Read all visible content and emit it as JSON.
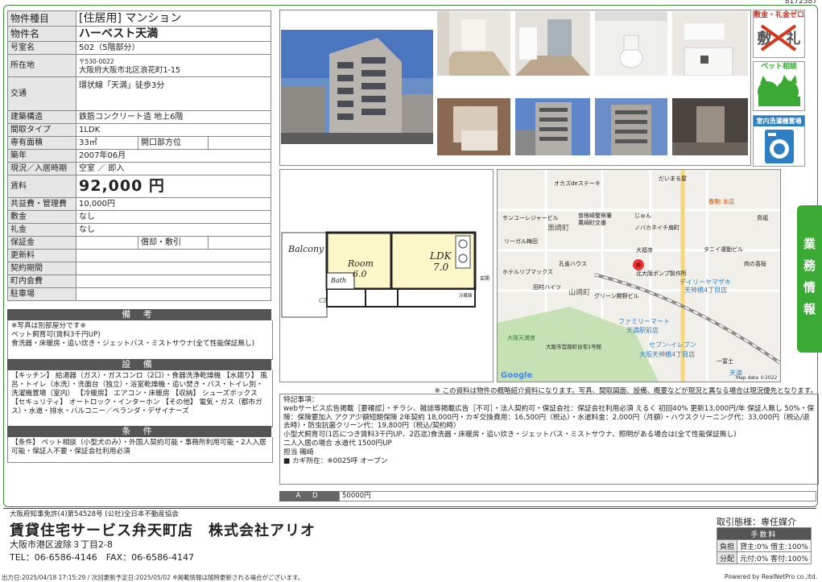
{
  "listing_id": "8172587",
  "property": {
    "rows": [
      {
        "label": "物件種目",
        "value": "[住居用] マンション"
      },
      {
        "label": "物件名",
        "value": "ハーベスト天満"
      },
      {
        "label": "号室名",
        "value": "502（5階部分）"
      },
      {
        "label": "所在地",
        "postal": "〒530-0022",
        "value": "大阪府大阪市北区浪花町1-15"
      },
      {
        "label": "交通",
        "value": "環状線「天満」徒歩3分"
      },
      {
        "label": "建築構造",
        "value": "鉄筋コンクリート造 地上6階"
      },
      {
        "label": "間取タイプ",
        "value": "1LDK"
      },
      {
        "label": "専有面積",
        "value": "33㎡",
        "sub_label": "開口部方位",
        "sub_value": ""
      },
      {
        "label": "築年",
        "value": "2007年06月"
      },
      {
        "label": "現況／入居時期",
        "value": "空室 ／ 即入"
      },
      {
        "label": "賃料",
        "value": "92,000 円"
      },
      {
        "label": "共益費・管理費",
        "value": "10,000円"
      },
      {
        "label": "敷金",
        "value": "なし"
      },
      {
        "label": "礼金",
        "value": "なし"
      },
      {
        "label": "保証金",
        "value": "",
        "sub_label": "償却・敷引",
        "sub_value": ""
      },
      {
        "label": "更新料",
        "value": ""
      },
      {
        "label": "契約期間",
        "value": ""
      },
      {
        "label": "町内会費",
        "value": ""
      },
      {
        "label": "駐車場",
        "value": ""
      }
    ]
  },
  "sections": {
    "biko_title": "備 考",
    "biko_text": "※写真は別部屋分です※\nペット飼育可(賃料3千円UP)\n食洗器・床暖房・追い炊き・ジェットバス・ミストサウナ(全て性能保証無し)",
    "setsubi_title": "設 備",
    "setsubi_text": "【キッチン】 給湯器（ガス）・ガスコンロ（2口）・食器洗浄乾燥機 【水廻り】 風呂・トイレ（水洗）・洗面台（独立）・浴室乾燥機・追い焚き・バス・トイレ別・洗濯機置場（室内） 【冷暖房】 エアコン・床暖房 【収納】 シューズボックス 【セキュリティ】 オートロック・インターホン 【その他】 電気・ガス（都市ガス）・水道・排水・バルコニー／ベランダ・デザイナーズ",
    "joken_title": "条 件",
    "joken_text": "【条件】 ペット相談（小型犬のみ）・外国人契約可能・事務所利用可能・2人入居可能・保証人不要・保証会社利用必須"
  },
  "badges": [
    {
      "label": "敷金・礼金ゼロ",
      "mark": "敷・礼",
      "icon": "no-deposit-icon"
    },
    {
      "label": "ペット相談",
      "icon": "pet-icon"
    },
    {
      "label": "室内洗濯機置場",
      "icon": "washing-machine-icon"
    }
  ],
  "floorplan": {
    "rooms": [
      "Balcony",
      "Room",
      "6.0",
      "LDK",
      "7.0",
      "Bath",
      "CL",
      "玄関",
      "冷蔵庫"
    ]
  },
  "map": {
    "labels": [
      "オカズdeステーキ",
      "だいまる屋",
      "春駒 本店",
      "鳥福",
      "曽根崎警察署",
      "萬崎町交番",
      "サンユーレジャービル",
      "じゅん",
      "ノバカネイチ扇町",
      "黒崎町",
      "リーガル梅田",
      "大福寺",
      "タニイ運動ビル",
      "ホテルリブマックス",
      "孔雀ハウス",
      "肉の喜桜",
      "北大阪ポンプ製作所",
      "デイリーヤマザキ",
      "天神橋4丁目店",
      "山崎町",
      "田村ハイツ",
      "グリーン開野ビル",
      "ファミリーマート",
      "天満駅前店",
      "大阪天満宮",
      "大阪市営扇町住宅1号館",
      "セブン-イレブン",
      "大阪天神橋4丁目店",
      "一富士",
      "天満",
      "Google",
      "Map data ©2022"
    ]
  },
  "disclaimer": "※ この資料は物件の概略紹介資料になります。写真、間取図面、設備、概要などが現況と異なる場合は現況優先となります。",
  "remarks": "特記事項：\nwebサービス広告掲載［要確認］・チラシ、雑誌等掲載広告［不可］・法人契約可・保証会社：保証会社利用必須 えるく 初回40% 更新13,000円/年 保証人無し 50%・保険：保険要加入 アクア少額短期保険 2年契約 18,000円・カギ交換費用：16,500円（税込）・水道料金：2,000円（月額）・ハウスクリーニング代：33,000円（税込/退去時）・防虫抗菌クリーン代：19,800円（税込/契約時）\n小型犬飼育可(1匹につき賃料3千円UP、2匹迄)食洗器・床暖房・追い炊き・ジェットバス・ミストサウナ、照明がある場合は(全て性能保証無し)\n二人入居の場合 水道代 1500円UP\n担当 磯崎\n■ カギ所在：※0025呼 オープン",
  "ad": {
    "label": "A D",
    "value": "50000円"
  },
  "side_tab": [
    "業",
    "務",
    "情",
    "報"
  ],
  "company": {
    "license": "大阪府知事免許(4)第54528号 (公社)全日本不動産協会",
    "name": "賃貸住宅サービス弁天町店　株式会社アリオ",
    "address": "大阪市港区波除３丁目2-8",
    "contact": "TEL：06-6586-4146　FAX：06-6586-4147"
  },
  "trade": {
    "form": "取引態様：専任媒介",
    "fee_header": "手数料",
    "rows": [
      {
        "key": "負担",
        "value": "貸主:0% 借主:100%"
      },
      {
        "key": "分配",
        "value": "元付:0% 客付:100%"
      }
    ]
  },
  "footer": {
    "output": "出力日:2025/04/18 17:15:29 / 次回更新予定日:2025/05/02 ※掲載情報は随時更新される場合がございます。",
    "powered": "Powered by RealNetPro co.,ltd."
  },
  "colors": {
    "accent": "#3aaa35",
    "header_gray": "#555555",
    "label_gray": "#e6e6e6"
  }
}
